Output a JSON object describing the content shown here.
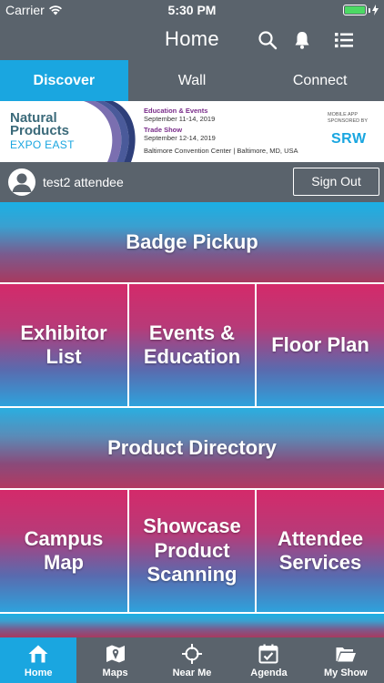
{
  "status": {
    "carrier": "Carrier",
    "time": "5:30 PM"
  },
  "header": {
    "title": "Home"
  },
  "tabs": [
    {
      "label": "Discover",
      "active": true
    },
    {
      "label": "Wall",
      "active": false
    },
    {
      "label": "Connect",
      "active": false
    }
  ],
  "banner": {
    "logo_line1": "Natural",
    "logo_line2": "Products",
    "logo_line3": "EXPO EAST",
    "edu_title": "Education & Events",
    "edu_dates": "September 11-14, 2019",
    "trade_title": "Trade Show",
    "trade_dates": "September 12-14, 2019",
    "venue": "Baltimore Convention Center | Baltimore, MD, USA",
    "sponsor_text": "MOBILE APP SPONSORED BY",
    "sponsor": "SRW"
  },
  "user": {
    "name": "test2 attendee",
    "signout_label": "Sign Out"
  },
  "tiles": {
    "badge_pickup": "Badge Pickup",
    "exhibitor_list": "Exhibitor List",
    "events_education": "Events & Education",
    "floor_plan": "Floor Plan",
    "product_directory": "Product Directory",
    "campus_map": "Campus Map",
    "showcase_scanning": "Showcase Product Scanning",
    "attendee_services": "Attendee Services"
  },
  "tabbar": [
    {
      "label": "Home",
      "icon": "home-icon",
      "active": true
    },
    {
      "label": "Maps",
      "icon": "map-icon",
      "active": false
    },
    {
      "label": "Near Me",
      "icon": "crosshair-icon",
      "active": false
    },
    {
      "label": "Agenda",
      "icon": "calendar-icon",
      "active": false
    },
    {
      "label": "My Show",
      "icon": "folder-icon",
      "active": false
    }
  ],
  "colors": {
    "accent": "#1aa6e0",
    "bar": "#5a636c",
    "magenta": "#d42a6a"
  }
}
